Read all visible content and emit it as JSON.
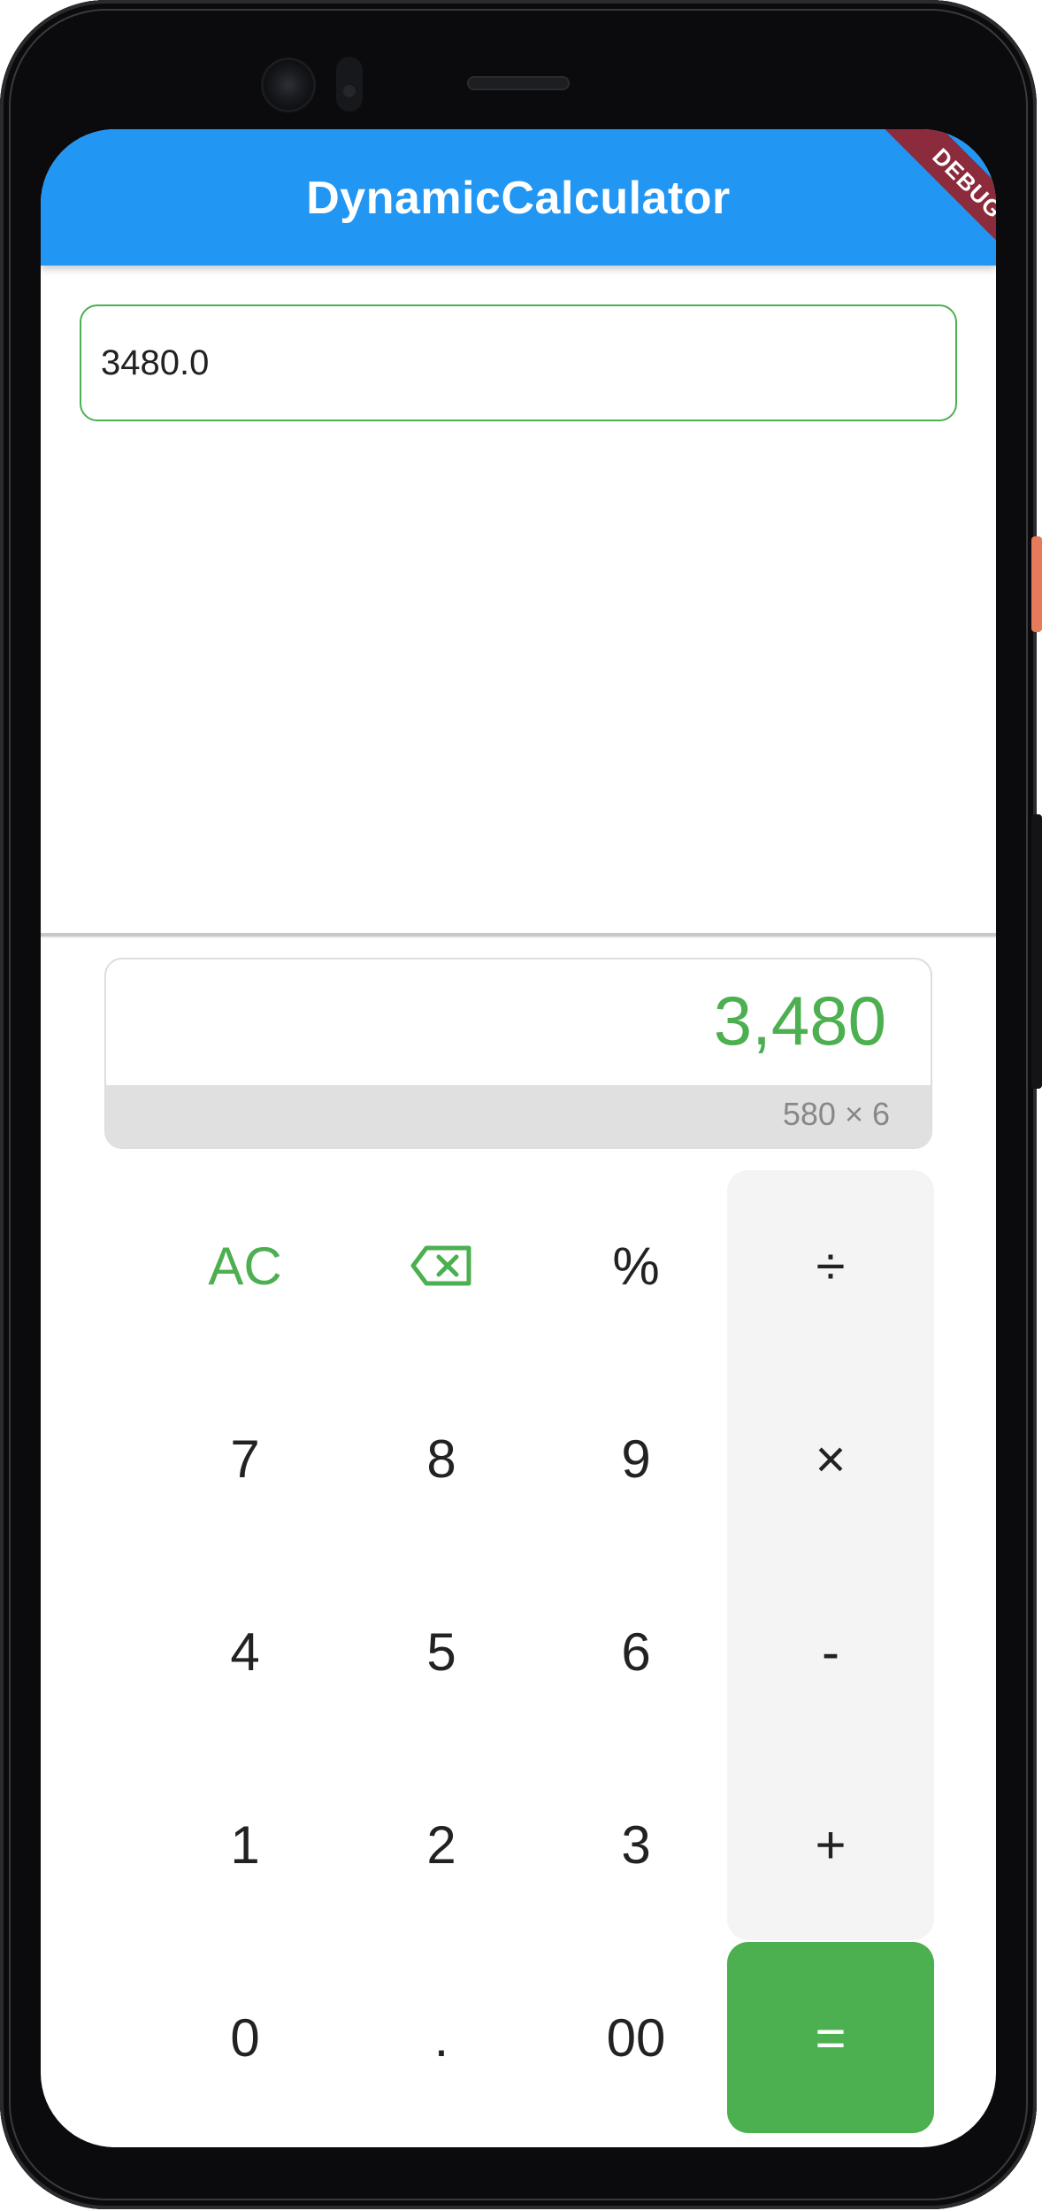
{
  "app": {
    "title": "DynamicCalculator",
    "debug_label": "DEBUG"
  },
  "expression_input": {
    "value": "3480.0"
  },
  "display": {
    "result": "3,480",
    "expression": "580 × 6"
  },
  "keypad": {
    "rows": [
      [
        {
          "label": "AC",
          "name": "clear-button",
          "style": "green"
        },
        {
          "label": "",
          "name": "backspace-button",
          "style": "icon",
          "icon": "backspace-icon"
        },
        {
          "label": "%",
          "name": "percent-button",
          "style": "normal"
        },
        {
          "label": "÷",
          "name": "divide-button",
          "style": "operator"
        }
      ],
      [
        {
          "label": "7",
          "name": "digit-7-button",
          "style": "normal"
        },
        {
          "label": "8",
          "name": "digit-8-button",
          "style": "normal"
        },
        {
          "label": "9",
          "name": "digit-9-button",
          "style": "normal"
        },
        {
          "label": "×",
          "name": "multiply-button",
          "style": "operator"
        }
      ],
      [
        {
          "label": "4",
          "name": "digit-4-button",
          "style": "normal"
        },
        {
          "label": "5",
          "name": "digit-5-button",
          "style": "normal"
        },
        {
          "label": "6",
          "name": "digit-6-button",
          "style": "normal"
        },
        {
          "label": "-",
          "name": "subtract-button",
          "style": "operator"
        }
      ],
      [
        {
          "label": "1",
          "name": "digit-1-button",
          "style": "normal"
        },
        {
          "label": "2",
          "name": "digit-2-button",
          "style": "normal"
        },
        {
          "label": "3",
          "name": "digit-3-button",
          "style": "normal"
        },
        {
          "label": "+",
          "name": "add-button",
          "style": "operator"
        }
      ],
      [
        {
          "label": "0",
          "name": "digit-0-button",
          "style": "normal"
        },
        {
          "label": ".",
          "name": "decimal-button",
          "style": "normal"
        },
        {
          "label": "00",
          "name": "double-zero-button",
          "style": "normal"
        },
        {
          "label": "=",
          "name": "equals-button",
          "style": "equals"
        }
      ]
    ]
  },
  "colors": {
    "appbar": "#2196f3",
    "accent_green": "#4caf50",
    "debug_ribbon": "#8b2b3c",
    "operator_column": "#f4f4f4"
  }
}
